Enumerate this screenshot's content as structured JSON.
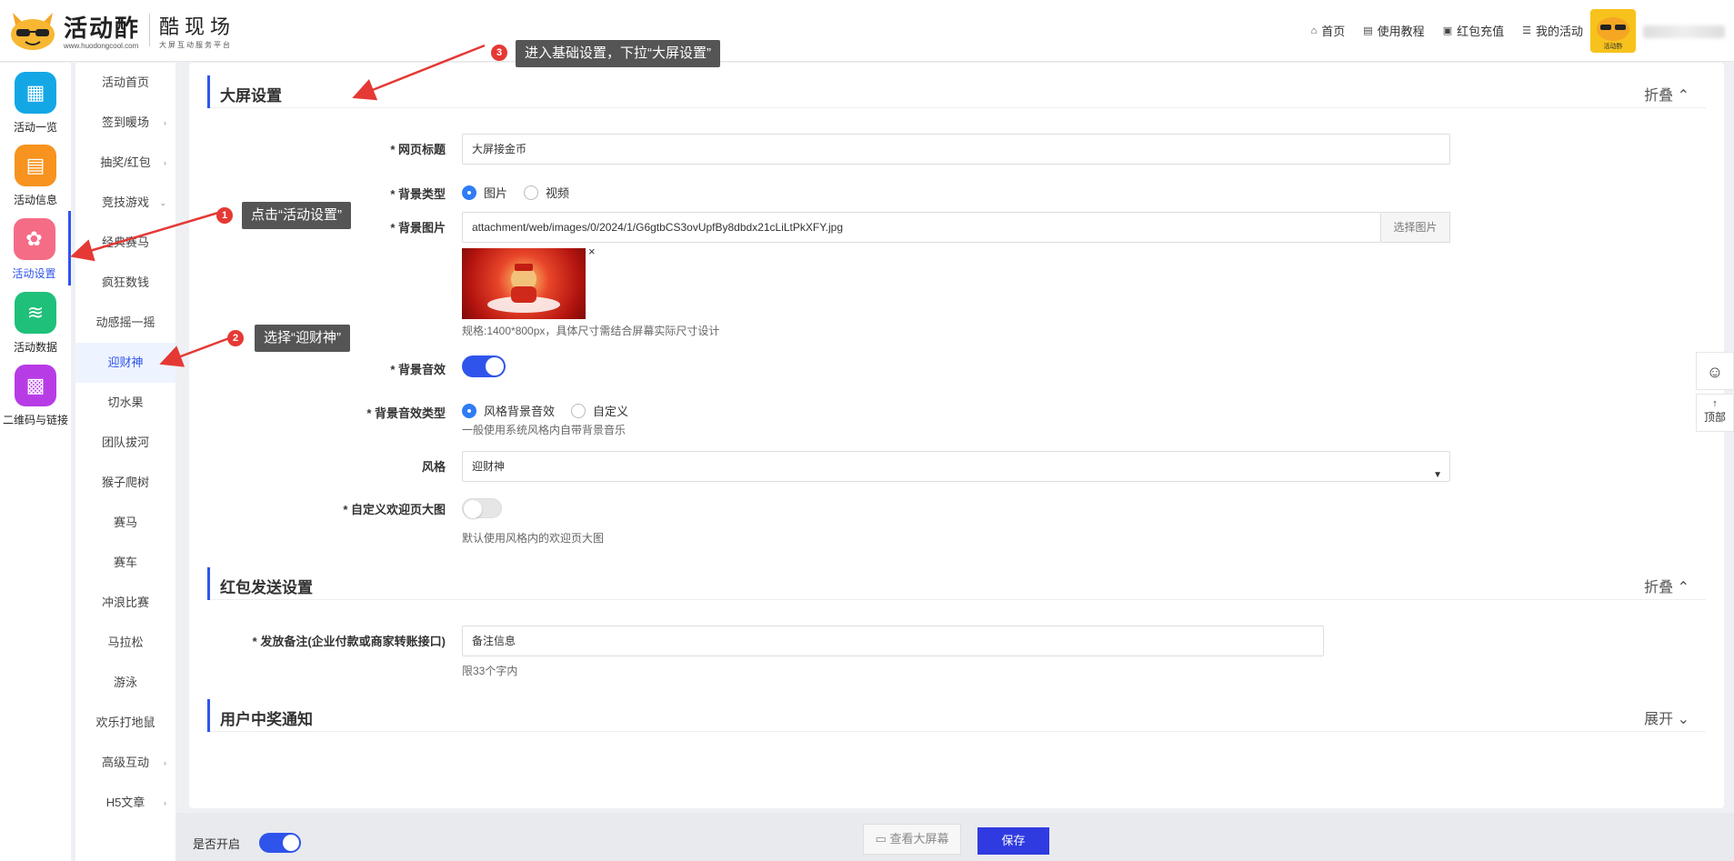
{
  "header": {
    "logo_main": "活动酢",
    "logo_url": "www.huodongcool.com",
    "logo_sub_main": "酷现场",
    "logo_sub_small": "大屏互动服务平台",
    "nav": [
      {
        "icon": "home-icon",
        "glyph": "⌂",
        "label": "首页"
      },
      {
        "icon": "book-icon",
        "glyph": "▤",
        "label": "使用教程"
      },
      {
        "icon": "wallet-icon",
        "glyph": "▣",
        "label": "红包充值"
      },
      {
        "icon": "list-icon",
        "glyph": "☰",
        "label": "我的活动"
      }
    ],
    "avatar_label": "活动酢"
  },
  "iconbar": [
    {
      "name": "activities",
      "label": "活动一览",
      "color": "#14a7e6",
      "glyph": "▦"
    },
    {
      "name": "info",
      "label": "活动信息",
      "color": "#f7931e",
      "glyph": "▤"
    },
    {
      "name": "settings",
      "label": "活动设置",
      "color": "#f56c86",
      "glyph": "✿"
    },
    {
      "name": "data",
      "label": "活动数据",
      "color": "#1fc07a",
      "glyph": "≋"
    },
    {
      "name": "qrcode",
      "label": "二维码与链接",
      "color": "#b83ce6",
      "glyph": "▩"
    }
  ],
  "submenu": [
    {
      "label": "活动首页",
      "arrow": ""
    },
    {
      "label": "签到暖场",
      "arrow": "›"
    },
    {
      "label": "抽奖/红包",
      "arrow": "›"
    },
    {
      "label": "竞技游戏",
      "arrow": "⌄"
    },
    {
      "label": "经典赛马",
      "arrow": ""
    },
    {
      "label": "疯狂数钱",
      "arrow": ""
    },
    {
      "label": "动感摇一摇",
      "arrow": ""
    },
    {
      "label": "迎财神",
      "arrow": ""
    },
    {
      "label": "切水果",
      "arrow": ""
    },
    {
      "label": "团队拔河",
      "arrow": ""
    },
    {
      "label": "猴子爬树",
      "arrow": ""
    },
    {
      "label": "赛马",
      "arrow": ""
    },
    {
      "label": "赛车",
      "arrow": ""
    },
    {
      "label": "冲浪比赛",
      "arrow": ""
    },
    {
      "label": "马拉松",
      "arrow": ""
    },
    {
      "label": "游泳",
      "arrow": ""
    },
    {
      "label": "欢乐打地鼠",
      "arrow": ""
    },
    {
      "label": "高级互动",
      "arrow": "›"
    },
    {
      "label": "H5文章",
      "arrow": "›"
    }
  ],
  "sections": {
    "screen": {
      "title": "大屏设置",
      "toggle": "折叠 ⌃"
    },
    "redpacket": {
      "title": "红包发送设置",
      "toggle": "折叠 ⌃"
    },
    "notify": {
      "title": "用户中奖通知",
      "toggle": "展开 ⌄"
    }
  },
  "form": {
    "page_title_label": "* 网页标题",
    "page_title_value": "大屏接金币",
    "bg_type_label": "* 背景类型",
    "bg_type_opt1": "图片",
    "bg_type_opt2": "视频",
    "bg_image_label": "* 背景图片",
    "bg_image_value": "attachment/web/images/0/2024/1/G6gtbCS3ovUpfBy8dbdx21cLiLtPkXFY.jpg",
    "bg_image_button": "选择图片",
    "bg_image_close": "×",
    "bg_image_hint": "规格:1400*800px，具体尺寸需结合屏幕实际尺寸设计",
    "bg_sound_label": "* 背景音效",
    "bg_sound_type_label": "* 背景音效类型",
    "bg_sound_opt1": "风格背景音效",
    "bg_sound_opt2": "自定义",
    "bg_sound_hint": "一般使用系统风格内自带背景音乐",
    "style_label": "风格",
    "style_value": "迎财神",
    "welcome_label": "* 自定义欢迎页大图",
    "welcome_hint": "默认使用风格内的欢迎页大图",
    "remark_label": "* 发放备注(企业付款或商家转账接口)",
    "remark_value": "备注信息",
    "remark_hint": "限33个字内"
  },
  "bottom": {
    "enabled_label": "是否开启",
    "preview_button": "查看大屏幕",
    "save_button": "保存"
  },
  "float": {
    "qq_glyph": "☺",
    "top_label": "顶部",
    "top_glyph": "↑"
  },
  "annotations": {
    "a1": {
      "num": "1",
      "text": "点击“活动设置”"
    },
    "a2": {
      "num": "2",
      "text": "选择“迎财神”"
    },
    "a3": {
      "num": "3",
      "text": "进入基础设置，下拉“大屏设置”"
    }
  },
  "colors": {
    "accent": "#2f54eb",
    "annotation": "#e53935"
  }
}
